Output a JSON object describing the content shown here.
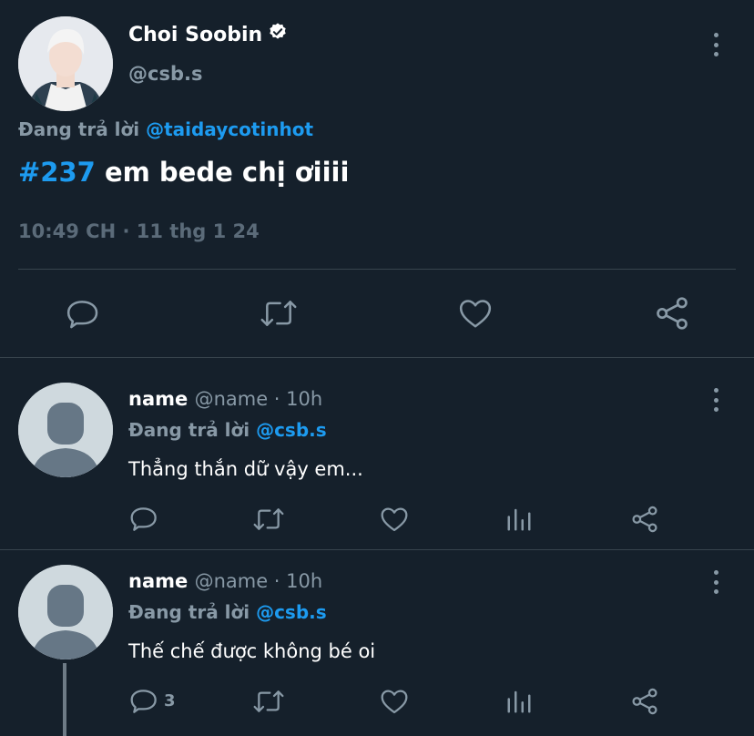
{
  "main_tweet": {
    "display_name": "Choi Soobin",
    "handle": "@csb.s",
    "replying_prefix": "Đang trả lời",
    "replying_to": "@taidaycotinhot",
    "hashtag": "#237",
    "text": " em bede chị ơiiii",
    "timestamp": "10:49 CH · 11 thg 1 24"
  },
  "replies": [
    {
      "name": "name",
      "handle_time": "@name · 10h",
      "replying_prefix": "Đang trả lời",
      "replying_to": "@csb.s",
      "text": "Thẳng thắn dữ vậy em...",
      "reply_count": ""
    },
    {
      "name": "name",
      "handle_time": "@name · 10h",
      "replying_prefix": "Đang trả lời",
      "replying_to": "@csb.s",
      "text": "Thế chế được không bé oi",
      "reply_count": "3"
    }
  ],
  "colors": {
    "background": "#15202b",
    "accent": "#1d9bf0",
    "secondary_text": "#8899a6",
    "divider": "#38444d"
  },
  "icons": [
    "verified-badge-icon",
    "more-options-icon",
    "reply-icon",
    "retweet-icon",
    "like-icon",
    "analytics-icon",
    "share-icon",
    "default-avatar-icon"
  ]
}
